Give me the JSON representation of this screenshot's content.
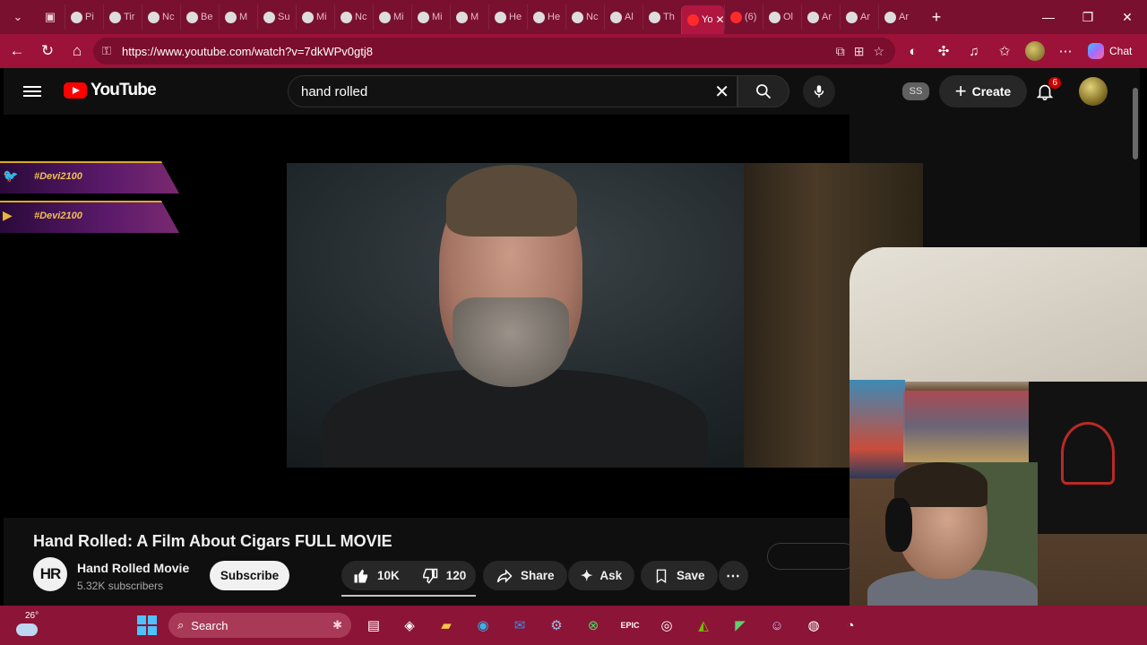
{
  "browser": {
    "tabs": [
      "Pi",
      "Tir",
      "Nc",
      "Be",
      "M",
      "Su",
      "Mi",
      "Nc",
      "Mi",
      "Mi",
      "M",
      "He",
      "He",
      "Nc",
      "Al",
      "Th",
      "Yo",
      "(6)",
      "Ol",
      "Ar",
      "Ar",
      "Ar"
    ],
    "active_tab_index": 16,
    "url": "https://www.youtube.com/watch?v=7dkWPv0gtj8",
    "chat_label": "Chat"
  },
  "youtube": {
    "logo_text": "YouTube",
    "search_query": "hand rolled",
    "ss_badge": "SS",
    "create_label": "Create",
    "notification_count": "6"
  },
  "overlay": {
    "social_handles": [
      {
        "platform_icon": "twitter-icon",
        "handle": "#Devi2100"
      },
      {
        "platform_icon": "youtube-icon",
        "handle": "#Devi2100"
      }
    ]
  },
  "video": {
    "title": "Hand Rolled: A Film About Cigars FULL MOVIE",
    "channel_avatar_text": "HR",
    "channel_name": "Hand Rolled Movie",
    "subscribers": "5.32K subscribers",
    "subscribe_label": "Subscribe",
    "likes": "10K",
    "dislikes": "120",
    "share_label": "Share",
    "ask_label": "Ask",
    "save_label": "Save"
  },
  "taskbar": {
    "temperature": "26°",
    "search_placeholder": "Search"
  },
  "colors": {
    "browser_accent": "#9c1239",
    "youtube_red": "#ff0000",
    "taskbar": "#8c1436"
  }
}
